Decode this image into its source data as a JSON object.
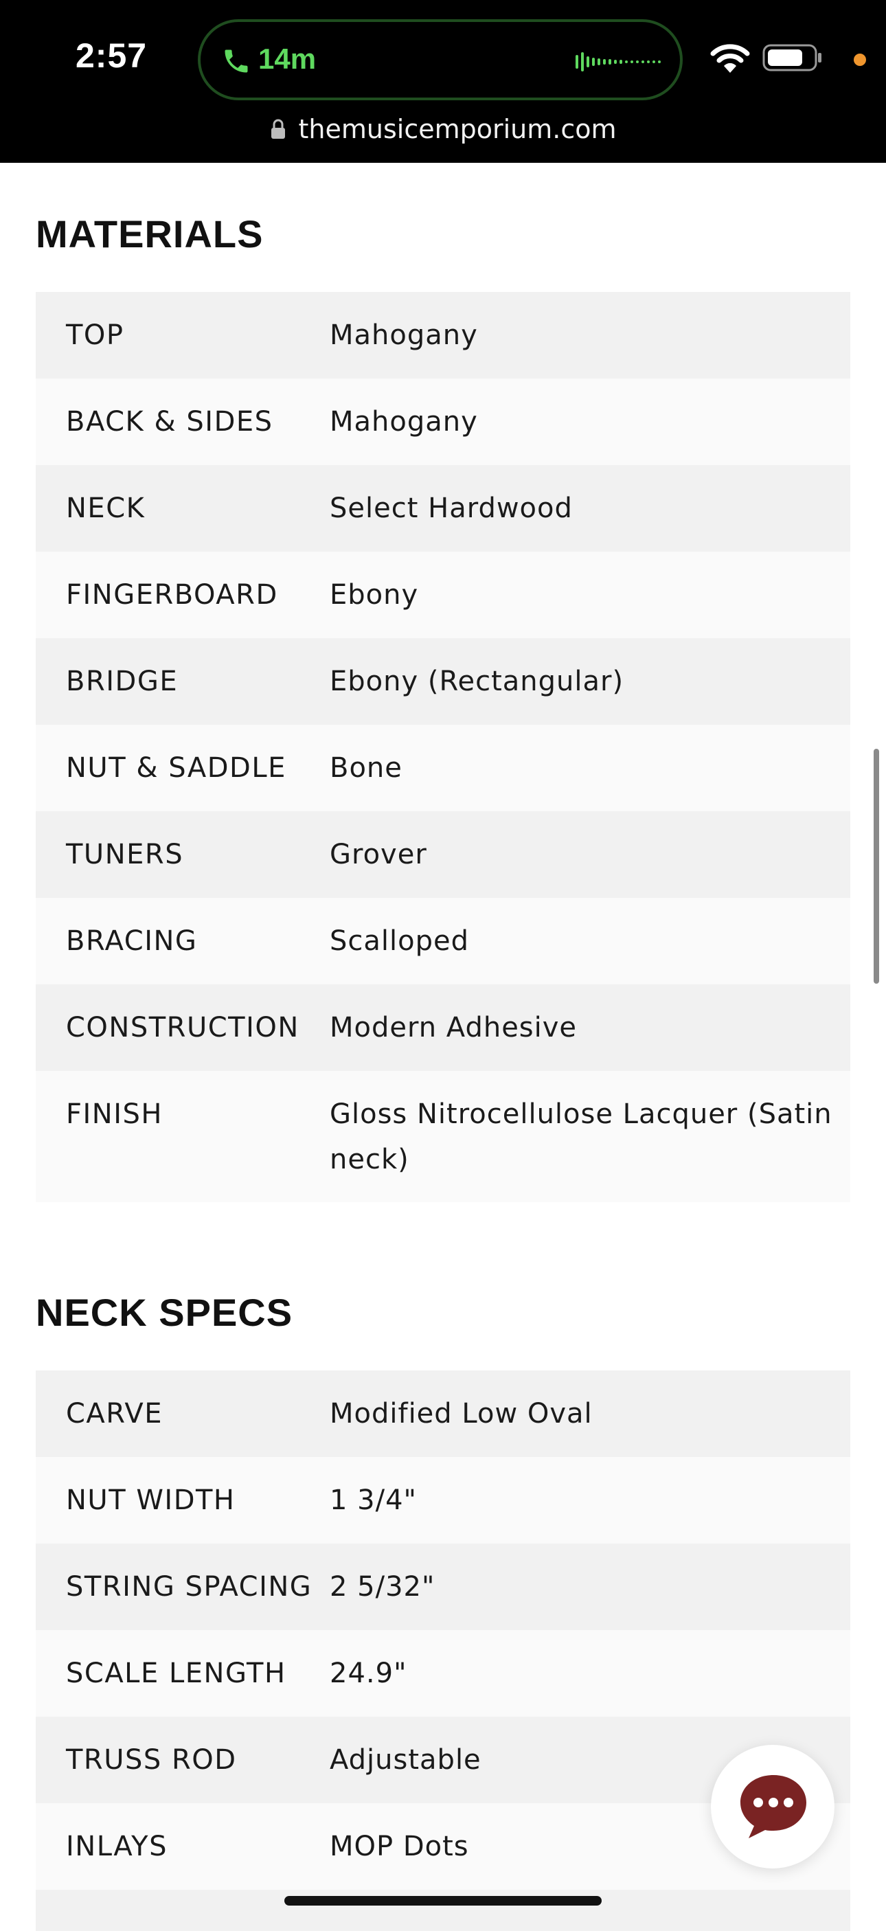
{
  "status_bar": {
    "time": "2:57",
    "call_duration": "14m",
    "call_color": "#5fd95f",
    "indicator_color": "#f0962e",
    "icons": [
      "phone-icon",
      "waveform-icon",
      "wifi-icon",
      "battery-icon"
    ]
  },
  "browser": {
    "url": "themusicemporium.com",
    "icons": [
      "lock-icon"
    ]
  },
  "materials": {
    "title": "MATERIALS",
    "rows": [
      {
        "label": "TOP",
        "value": "Mahogany"
      },
      {
        "label": "BACK & SIDES",
        "value": "Mahogany"
      },
      {
        "label": "NECK",
        "value": "Select Hardwood"
      },
      {
        "label": "FINGERBOARD",
        "value": "Ebony"
      },
      {
        "label": "BRIDGE",
        "value": "Ebony (Rectangular)"
      },
      {
        "label": "NUT & SADDLE",
        "value": "Bone"
      },
      {
        "label": "TUNERS",
        "value": "Grover"
      },
      {
        "label": "BRACING",
        "value": "Scalloped"
      },
      {
        "label": "CONSTRUCTION",
        "value": "Modern Adhesive"
      },
      {
        "label": "FINISH",
        "value": "Gloss Nitrocellulose Lacquer (Satin neck)"
      }
    ]
  },
  "neck_specs": {
    "title": "NECK SPECS",
    "rows": [
      {
        "label": "CARVE",
        "value": "Modified Low Oval"
      },
      {
        "label": "NUT WIDTH",
        "value": "1 3/4\""
      },
      {
        "label": "STRING SPACING",
        "value": "2 5/32\""
      },
      {
        "label": "SCALE LENGTH",
        "value": "24.9\""
      },
      {
        "label": "TRUSS ROD",
        "value": "Adjustable"
      },
      {
        "label": "INLAYS",
        "value": "MOP Dots"
      }
    ]
  },
  "chat": {
    "icon": "chat-bubble-icon",
    "color": "#7a2323"
  }
}
